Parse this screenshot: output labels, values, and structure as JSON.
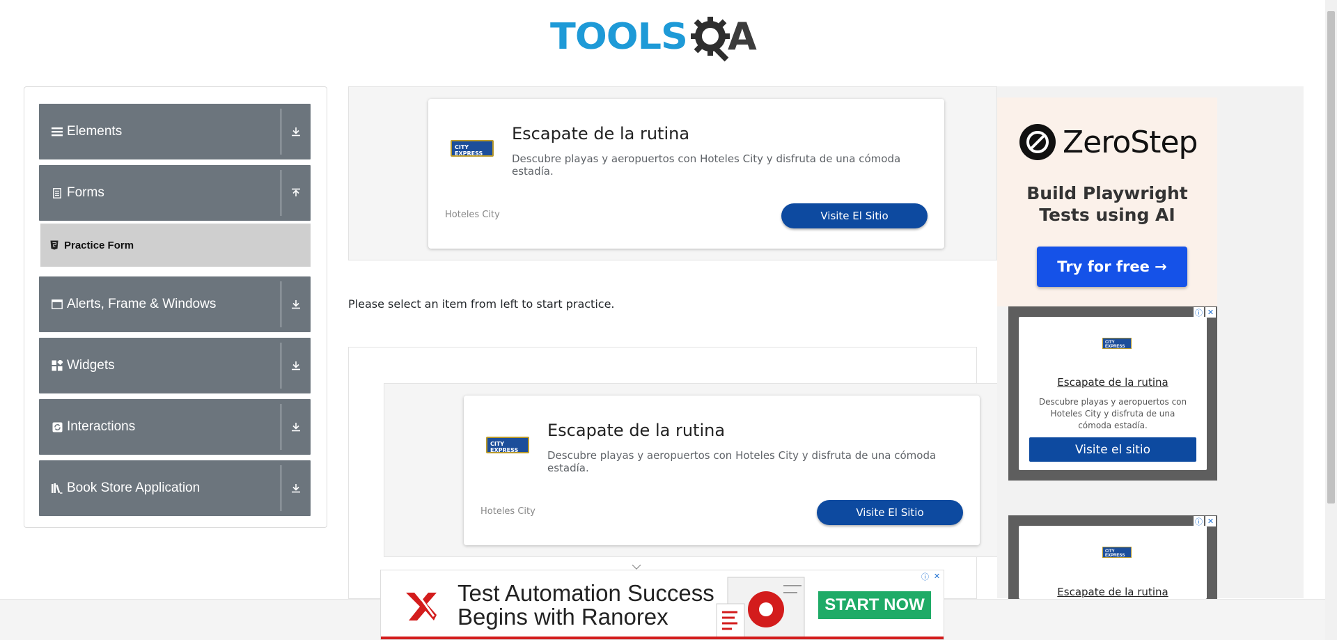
{
  "logo": {
    "tools": "TOOLS",
    "qa": "A"
  },
  "sidebar": {
    "groups": [
      {
        "label": "Elements",
        "icon": "list-icon",
        "expanded": false
      },
      {
        "label": "Forms",
        "icon": "document-icon",
        "expanded": true
      },
      {
        "label": "Alerts, Frame & Windows",
        "icon": "window-icon",
        "expanded": false
      },
      {
        "label": "Widgets",
        "icon": "widgets-icon",
        "expanded": false
      },
      {
        "label": "Interactions",
        "icon": "interaction-icon",
        "expanded": false
      },
      {
        "label": "Book Store Application",
        "icon": "books-icon",
        "expanded": false
      }
    ],
    "forms_subitem": {
      "label": "Practice Form",
      "icon": "html5-icon"
    }
  },
  "main": {
    "prompt": "Please select an item from left to start practice.",
    "ad1": {
      "logo": "CITY EXPRESS",
      "title": "Escapate de la rutina",
      "desc": "Descubre playas y aeropuertos con Hoteles City y disfruta de una cómoda estadía.",
      "brand": "Hoteles City",
      "button": "Visite El Sitio"
    },
    "ad2": {
      "logo": "CITY EXPRESS",
      "title": "Escapate de la rutina",
      "desc": "Descubre playas y aeropuertos con Hoteles City y disfruta de una cómoda estadía.",
      "brand": "Hoteles City",
      "button": "Visite El Sitio"
    }
  },
  "right_ads": {
    "zerostep": {
      "name": "ZeroStep",
      "tagline_1": "Build Playwright",
      "tagline_2": "Tests using AI",
      "button": "Try for free →"
    },
    "city1": {
      "logo": "CITY EXPRESS",
      "title": "Escapate de la rutina",
      "desc": "Descubre playas y aeropuertos con Hoteles City y disfruta de una cómoda estadía.",
      "button": "Visite el sitio"
    },
    "city2": {
      "logo": "CITY EXPRESS",
      "title": "Escapate de la rutina"
    },
    "info_icon": "ⓘ",
    "close_icon": "✕"
  },
  "bottom_banner": {
    "line1": "Test Automation Success",
    "line2": "Begins with Ranorex",
    "button": "START NOW"
  },
  "colors": {
    "sidebar_group": "#6c757d",
    "subitem_active": "#cfcfcf",
    "ad_button": "#0d4aa0",
    "zerostep_button": "#1552e8",
    "ranorex_button": "#1fab67",
    "logo_blue": "#1e9ad7"
  }
}
